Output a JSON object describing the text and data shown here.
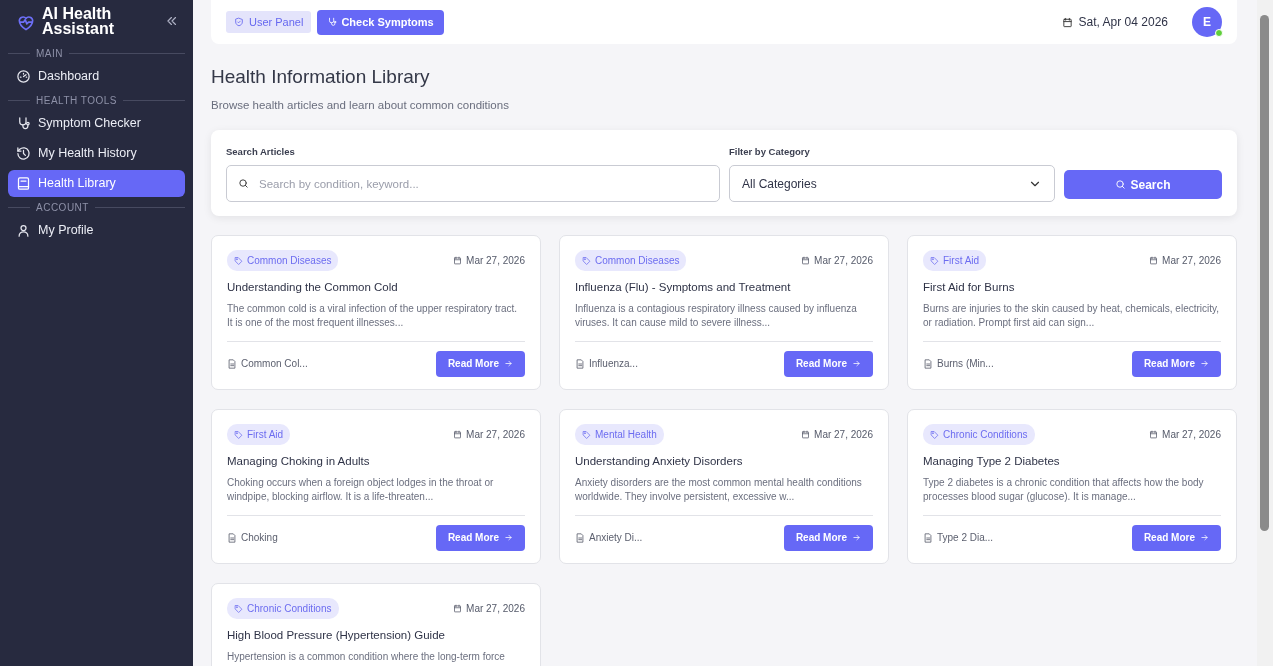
{
  "sidebar": {
    "brand": "AI Health Assistant",
    "sections": [
      {
        "heading": "MAIN",
        "items": [
          {
            "label": "Dashboard",
            "selected": false
          }
        ]
      },
      {
        "heading": "HEALTH TOOLS",
        "items": [
          {
            "label": "Symptom Checker",
            "selected": false
          },
          {
            "label": "My Health History",
            "selected": false
          },
          {
            "label": "Health Library",
            "selected": true
          }
        ]
      },
      {
        "heading": "ACCOUNT",
        "items": [
          {
            "label": "My Profile",
            "selected": false
          }
        ]
      }
    ]
  },
  "topbar": {
    "buttons": [
      {
        "label": "User Panel",
        "kind": "light"
      },
      {
        "label": "Check Symptoms",
        "kind": "primary"
      }
    ],
    "date": "Sat, Apr 04 2026",
    "avatar": {
      "initial": "E",
      "online": true
    }
  },
  "page": {
    "title": "Health Information Library",
    "subtitle": "Browse health articles and learn about common conditions"
  },
  "filters": {
    "search_label": "Search Articles",
    "search_placeholder": "Search by condition, keyword...",
    "category_label": "Filter by Category",
    "category_value": "All Categories",
    "button": "Search"
  },
  "articles": [
    {
      "tag": "Common Diseases",
      "date": "Mar 27, 2026",
      "title": "Understanding the Common Cold",
      "excerpt": "The common cold is a viral infection of the upper respiratory tract. It is one of the most frequent illnesses...",
      "source": "Common Col...",
      "button": "Read More"
    },
    {
      "tag": "Common Diseases",
      "date": "Mar 27, 2026",
      "title": "Influenza (Flu) - Symptoms and Treatment",
      "excerpt": "Influenza is a contagious respiratory illness caused by influenza viruses. It can cause mild to severe illness...",
      "source": "Influenza...",
      "button": "Read More"
    },
    {
      "tag": "First Aid",
      "date": "Mar 27, 2026",
      "title": "First Aid for Burns",
      "excerpt": "Burns are injuries to the skin caused by heat, chemicals, electricity, or radiation. Prompt first aid can sign...",
      "source": "Burns (Min...",
      "button": "Read More"
    },
    {
      "tag": "First Aid",
      "date": "Mar 27, 2026",
      "title": "Managing Choking in Adults",
      "excerpt": "Choking occurs when a foreign object lodges in the throat or windpipe, blocking airflow. It is a life-threaten...",
      "source": "Choking",
      "button": "Read More"
    },
    {
      "tag": "Mental Health",
      "date": "Mar 27, 2026",
      "title": "Understanding Anxiety Disorders",
      "excerpt": "Anxiety disorders are the most common mental health conditions worldwide. They involve persistent, excessive w...",
      "source": "Anxiety Di...",
      "button": "Read More"
    },
    {
      "tag": "Chronic Conditions",
      "date": "Mar 27, 2026",
      "title": "Managing Type 2 Diabetes",
      "excerpt": "Type 2 diabetes is a chronic condition that affects how the body processes blood sugar (glucose). It is manage...",
      "source": "Type 2 Dia...",
      "button": "Read More"
    },
    {
      "tag": "Chronic Conditions",
      "date": "Mar 27, 2026",
      "title": "High Blood Pressure (Hypertension) Guide",
      "excerpt": "Hypertension is a common condition where the long-term force"
    }
  ]
}
